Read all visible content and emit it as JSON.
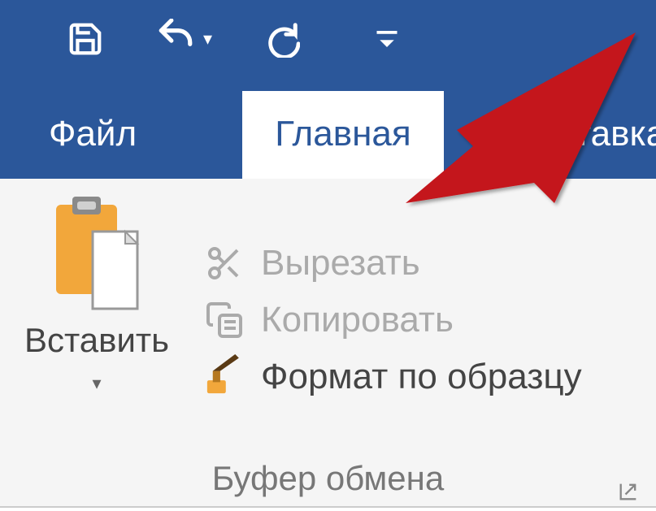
{
  "colors": {
    "ribbon_blue": "#2b579a",
    "arrow_red": "#c4141a",
    "accent_orange": "#f2a73b",
    "disabled_gray": "#aaaaaa"
  },
  "quick_access": {
    "save": "save",
    "undo": "undo",
    "redo": "redo",
    "customize": "customize"
  },
  "tabs": {
    "file": "Файл",
    "home": "Главная",
    "insert": "Вставка"
  },
  "ribbon": {
    "paste": {
      "label": "Вставить"
    },
    "clipboard": {
      "cut": "Вырезать",
      "copy": "Копировать",
      "format_painter": "Формат по образцу",
      "group_label": "Буфер обмена"
    }
  }
}
